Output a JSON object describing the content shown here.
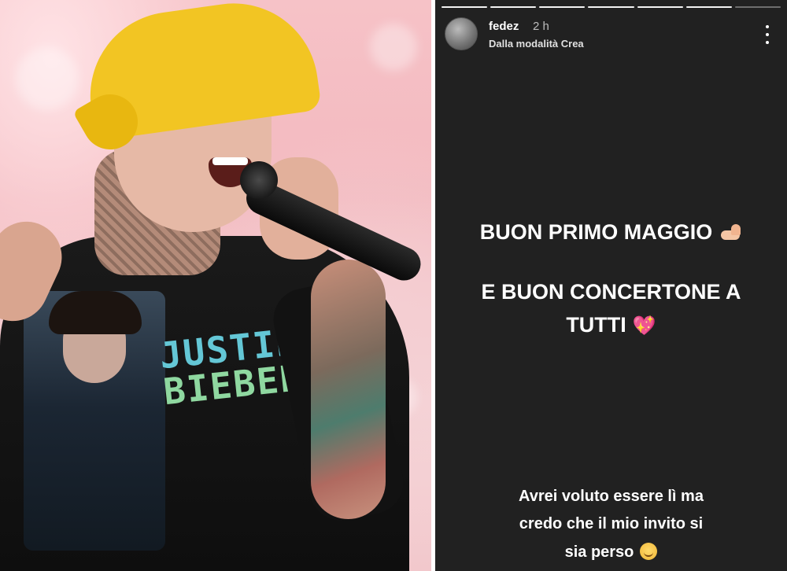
{
  "photo": {
    "shirt_text_line1": "JUSTIN",
    "shirt_text_line2": "BIEBER"
  },
  "story": {
    "progress_total": 7,
    "progress_done": 6,
    "header": {
      "username": "fedez",
      "time": "2 h",
      "subtitle": "Dalla modalità Crea",
      "more_icon": "more-vertical-icon"
    },
    "main": {
      "line1": "BUON PRIMO MAGGIO",
      "line2": "E BUON CONCERTONE A",
      "line3": "TUTTI"
    },
    "bottom": {
      "line1": "Avrei voluto essere lì ma",
      "line2": "credo che il mio invito si",
      "line3": "sia perso"
    },
    "emojis": {
      "line1": "flexed-biceps",
      "line3": "sparkling-heart",
      "bottom": "sweat-smile"
    },
    "colors": {
      "background": "#212121",
      "heart": "#ff5fa8",
      "cap": "#f2c523"
    }
  }
}
